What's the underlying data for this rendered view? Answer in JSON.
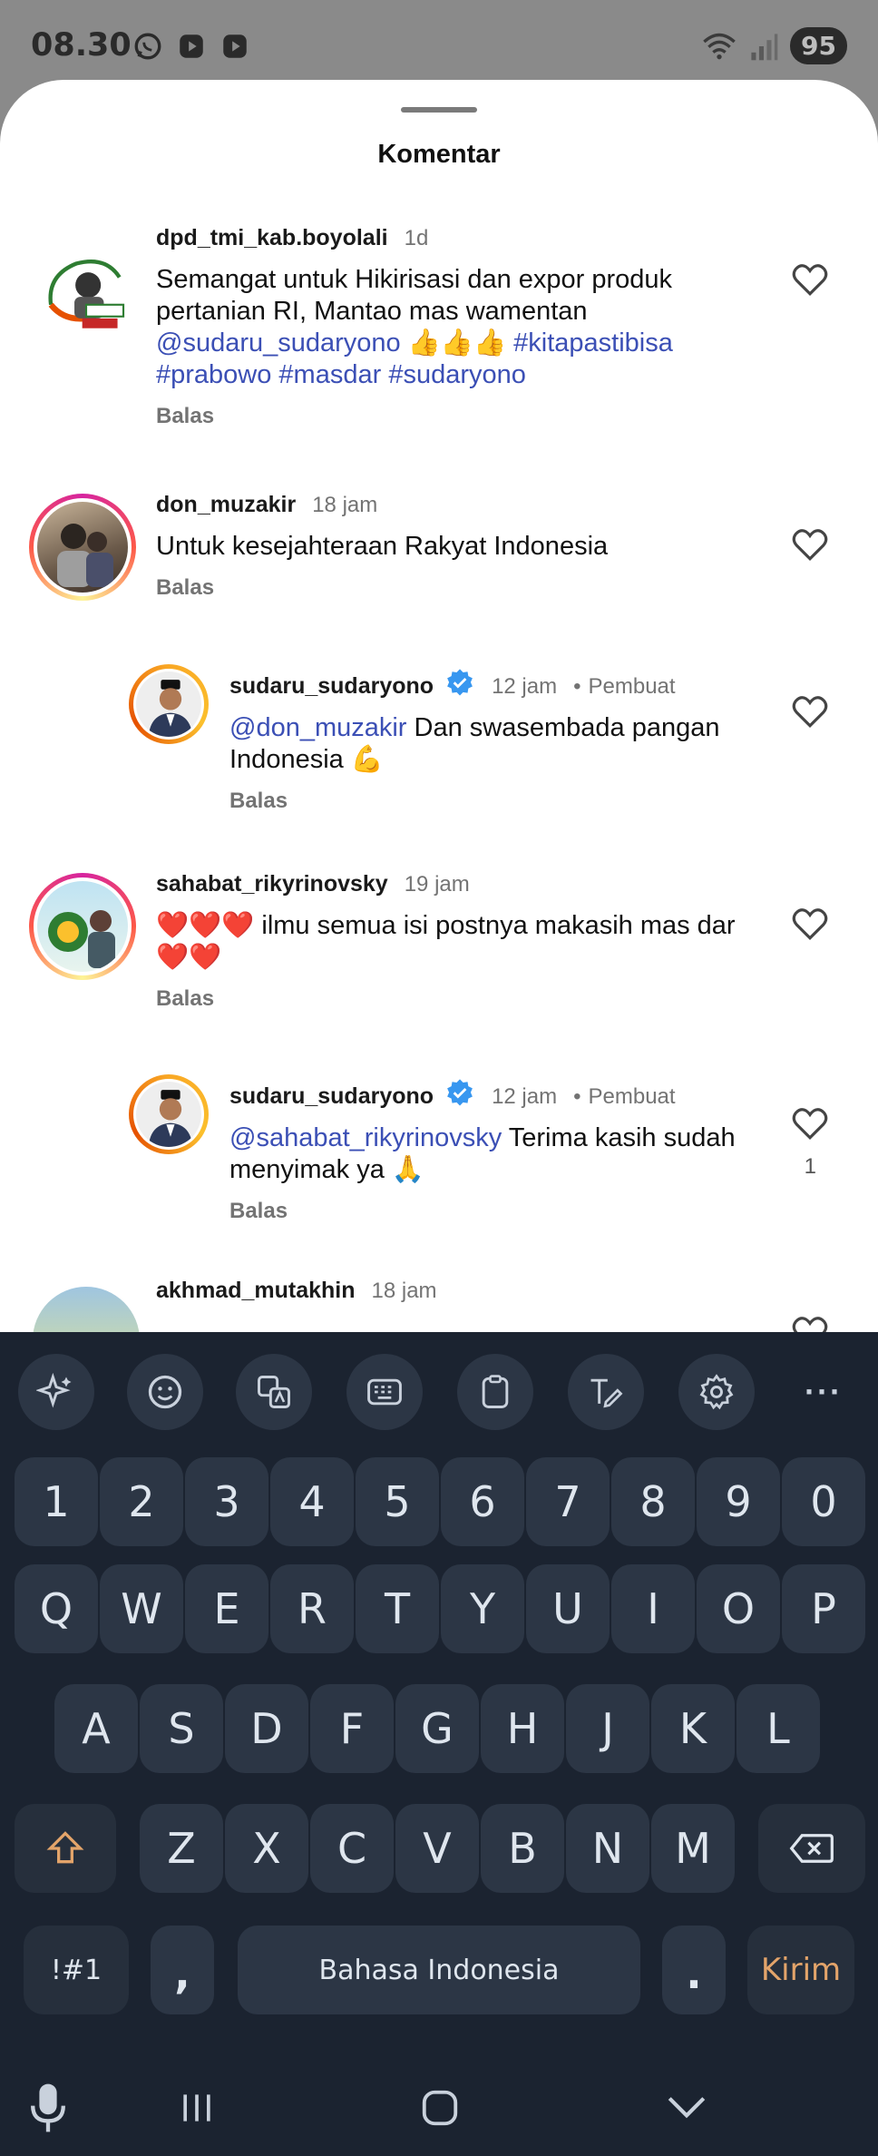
{
  "status_bar": {
    "time": "08.30",
    "battery": "95",
    "left_icons": [
      "whatsapp-icon",
      "play-icon",
      "play-icon"
    ],
    "right_icons": [
      "wifi-icon",
      "signal-icon"
    ]
  },
  "sheet": {
    "title": "Komentar"
  },
  "comments": [
    {
      "user": "dpd_tmi_kab.boyolali",
      "time": "1d",
      "text_parts": [
        {
          "t": "Semangat untuk Hikirisasi dan expor produk pertanian RI, Mantao mas wamentan ",
          "m": false
        },
        {
          "t": "@sudaru_sudaryono",
          "m": true
        },
        {
          "t": " 👍👍👍 ",
          "m": false
        },
        {
          "t": "#kitapastibisa #prabowo  #masdar #sudaryono",
          "m": true
        }
      ],
      "reply": "Balas"
    },
    {
      "user": "don_muzakir",
      "time": "18 jam",
      "text_parts": [
        {
          "t": "Untuk kesejahteraan Rakyat Indonesia",
          "m": false
        }
      ],
      "reply": "Balas"
    },
    {
      "user": "sudaru_sudaryono",
      "time": "12 jam",
      "creator": "Pembuat",
      "text_parts": [
        {
          "t": "@don_muzakir",
          "m": true
        },
        {
          "t": " Dan swasembada pangan Indonesia 💪",
          "m": false
        }
      ],
      "reply": "Balas"
    },
    {
      "user": "sahabat_rikyrinovsky",
      "time": "19 jam",
      "text_parts": [
        {
          "t": "❤️❤️❤️ ilmu semua isi postnya makasih mas dar ❤️❤️",
          "m": false
        }
      ],
      "reply": "Balas"
    },
    {
      "user": "sudaru_sudaryono",
      "time": "12 jam",
      "creator": "Pembuat",
      "text_parts": [
        {
          "t": "@sahabat_rikyrinovsky",
          "m": true
        },
        {
          "t": " Terima kasih sudah menyimak ya 🙏",
          "m": false
        }
      ],
      "reply": "Balas",
      "likes": "1"
    },
    {
      "user": "akhmad_mutakhin",
      "time": "18 jam"
    }
  ],
  "keyboard": {
    "toolbar": [
      "sparkle-icon",
      "emoji-icon",
      "translate-icon",
      "keyboard-icon",
      "clipboard-icon",
      "handwriting-icon",
      "settings-icon",
      "more-icon"
    ],
    "more_label": "···",
    "number_row": [
      "1",
      "2",
      "3",
      "4",
      "5",
      "6",
      "7",
      "8",
      "9",
      "0"
    ],
    "row1": [
      "Q",
      "W",
      "E",
      "R",
      "T",
      "Y",
      "U",
      "I",
      "O",
      "P"
    ],
    "row2": [
      "A",
      "S",
      "D",
      "F",
      "G",
      "H",
      "J",
      "K",
      "L"
    ],
    "row3": [
      "Z",
      "X",
      "C",
      "V",
      "B",
      "N",
      "M"
    ],
    "symbols_label": "!#1",
    "comma_label": ",",
    "space_label": "Bahasa Indonesia",
    "period_label": ".",
    "send_label": "Kirim",
    "shift_icon": "shift-icon",
    "backspace_icon": "backspace-icon"
  },
  "nav_bar": {
    "items": [
      "microphone-icon",
      "recents-icon",
      "home-icon",
      "hide-keyboard-icon"
    ]
  },
  "colors": {
    "mention": "#3b4fb5",
    "keyboard_bg": "#1b2330",
    "key_bg": "#2c3645",
    "send_text": "#e3a46a",
    "verified": "#3897f0"
  }
}
